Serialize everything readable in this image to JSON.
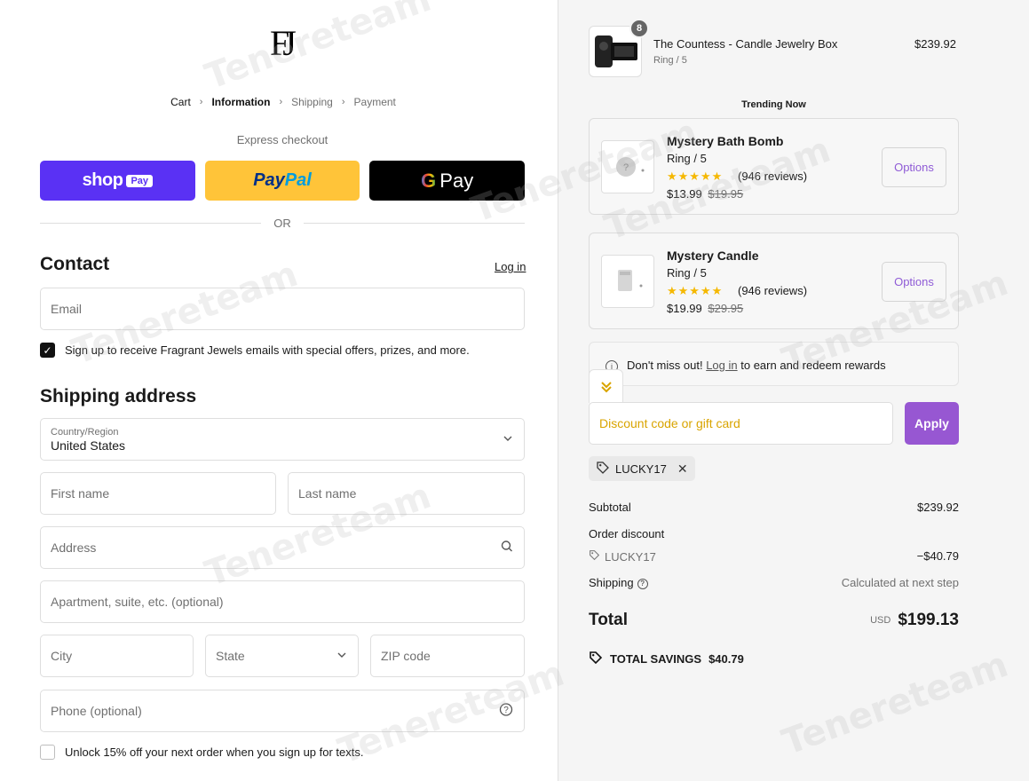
{
  "brand": {
    "logo_text": "FJ"
  },
  "breadcrumb": [
    {
      "label": "Cart"
    },
    {
      "label": "Information"
    },
    {
      "label": "Shipping"
    },
    {
      "label": "Payment"
    }
  ],
  "breadcrumb_sep": "›",
  "express": {
    "label": "Express checkout",
    "shop_pay_text": "shop",
    "shop_pay_badge": "Pay",
    "paypal_a": "Pay",
    "paypal_b": "Pal",
    "gpay_g": "G",
    "gpay_text": "Pay",
    "or": "OR"
  },
  "contact": {
    "heading": "Contact",
    "login_label": "Log in",
    "email_placeholder": "Email",
    "newsletter_label": "Sign up to receive Fragrant Jewels emails with special offers, prizes, and more."
  },
  "shipping": {
    "heading": "Shipping address",
    "country_label": "Country/Region",
    "country_value": "United States",
    "first_name": "First name",
    "last_name": "Last name",
    "address": "Address",
    "apartment": "Apartment, suite, etc. (optional)",
    "city": "City",
    "state": "State",
    "zip": "ZIP code",
    "phone": "Phone (optional)",
    "sms_label": "Unlock 15% off your next order when you sign up for texts."
  },
  "order": {
    "item": {
      "name": "The Countess - Candle Jewelry Box",
      "variant": "Ring / 5",
      "price": "$239.92",
      "quantity": "8"
    },
    "trending_label": "Trending Now",
    "upsells": [
      {
        "name": "Mystery Bath Bomb",
        "variant": "Ring / 5",
        "stars": "★★★★★",
        "reviews": "(946 reviews)",
        "price": "$13.99",
        "compare": "$19.95",
        "button": "Options"
      },
      {
        "name": "Mystery Candle",
        "variant": "Ring / 5",
        "stars": "★★★★★",
        "reviews": "(946 reviews)",
        "price": "$19.99",
        "compare": "$29.95",
        "button": "Options"
      }
    ],
    "rewards": {
      "prefix": "Don't miss out!",
      "link": "Log in",
      "suffix": "to earn and redeem rewards"
    },
    "discount_placeholder": "Discount code or gift card",
    "apply_label": "Apply",
    "applied_code": "LUCKY17",
    "subtotal_label": "Subtotal",
    "subtotal_value": "$239.92",
    "order_discount_label": "Order discount",
    "discount_code": "LUCKY17",
    "discount_value": "−$40.79",
    "shipping_label": "Shipping",
    "shipping_value": "Calculated at next step",
    "total_label": "Total",
    "currency": "USD",
    "total_value": "$199.13",
    "savings_label": "TOTAL SAVINGS",
    "savings_value": "$40.79"
  },
  "watermark": "Tenereteam",
  "colors": {
    "shop_pay": "#5a31f4",
    "paypal": "#ffc439",
    "accent": "#9757d2",
    "stars": "#f5b800"
  }
}
